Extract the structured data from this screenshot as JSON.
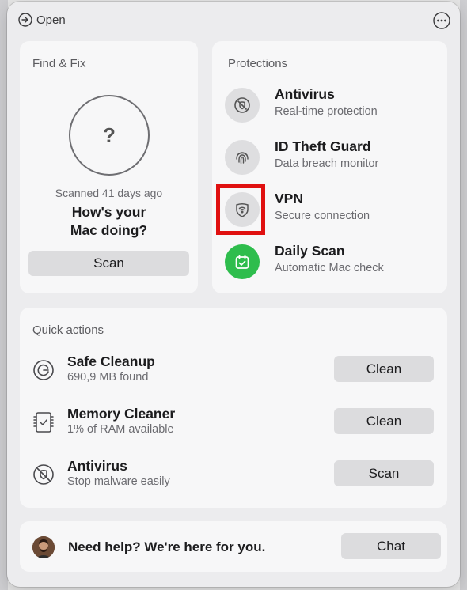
{
  "topbar": {
    "open_label": "Open"
  },
  "find_fix": {
    "title": "Find & Fix",
    "status_symbol": "?",
    "scanned_text": "Scanned 41 days ago",
    "question_line1": "How's your",
    "question_line2": "Mac doing?",
    "scan_button": "Scan"
  },
  "protections": {
    "title": "Protections",
    "items": [
      {
        "name": "Antivirus",
        "subtitle": "Real-time protection",
        "icon": "shield-slash-icon"
      },
      {
        "name": "ID Theft Guard",
        "subtitle": "Data breach monitor",
        "icon": "fingerprint-icon"
      },
      {
        "name": "VPN",
        "subtitle": "Secure connection",
        "icon": "wifi-shield-icon",
        "highlighted": true
      },
      {
        "name": "Daily Scan",
        "subtitle": "Automatic Mac check",
        "icon": "calendar-check-icon",
        "active": true
      }
    ]
  },
  "quick_actions": {
    "title": "Quick actions",
    "items": [
      {
        "name": "Safe Cleanup",
        "subtitle": "690,9 MB found",
        "button": "Clean",
        "icon": "cleanup-icon"
      },
      {
        "name": "Memory Cleaner",
        "subtitle": "1% of RAM available",
        "button": "Clean",
        "icon": "memory-chip-icon"
      },
      {
        "name": "Antivirus",
        "subtitle": "Stop malware easily",
        "button": "Scan",
        "icon": "antivirus-icon"
      }
    ]
  },
  "help": {
    "text": "Need help? We're here for you.",
    "button": "Chat"
  },
  "colors": {
    "accent_green": "#2ebd4d",
    "highlight_red": "#e01010"
  }
}
